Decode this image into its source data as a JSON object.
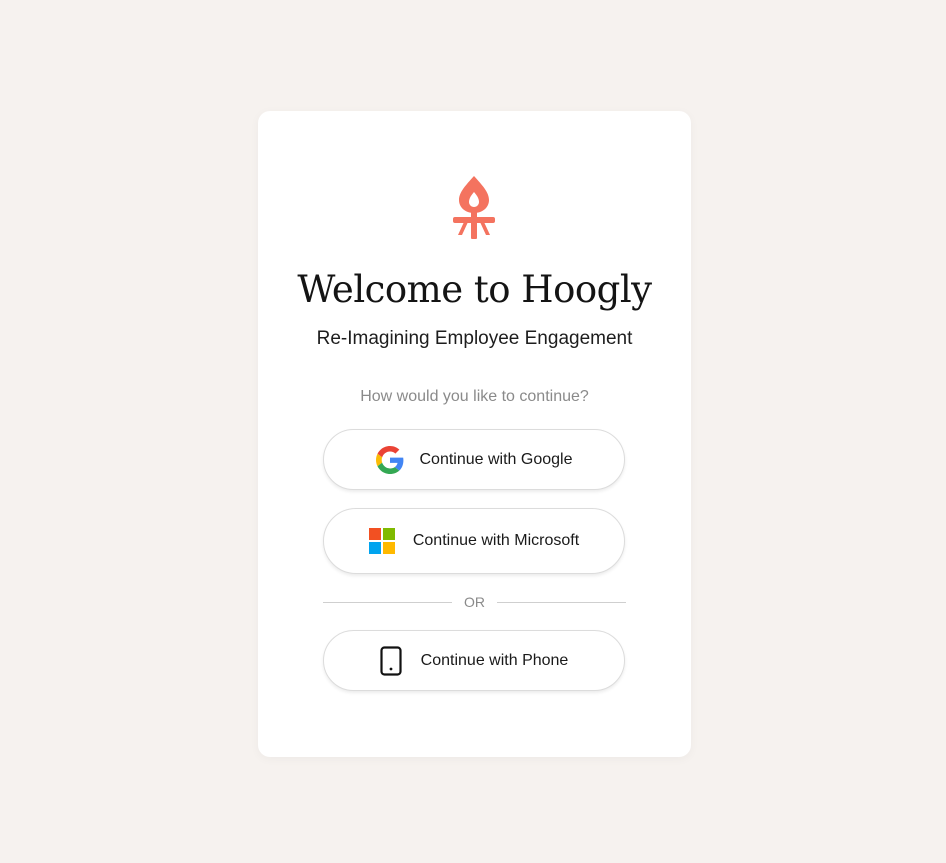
{
  "card": {
    "logo_icon": "hoogly-flame-logo-icon",
    "title": "Welcome to Hoogly",
    "subtitle": "Re-Imagining Employee Engagement",
    "prompt": "How would you like to continue?"
  },
  "buttons": {
    "google": {
      "label": "Continue with Google",
      "icon": "google-icon"
    },
    "microsoft": {
      "label": "Continue with Microsoft",
      "icon": "microsoft-icon"
    },
    "phone": {
      "label": "Continue with Phone",
      "icon": "phone-icon"
    }
  },
  "divider": {
    "text": "OR"
  },
  "colors": {
    "brand": "#f4735f",
    "background": "#f6f2ef",
    "card": "#ffffff"
  }
}
